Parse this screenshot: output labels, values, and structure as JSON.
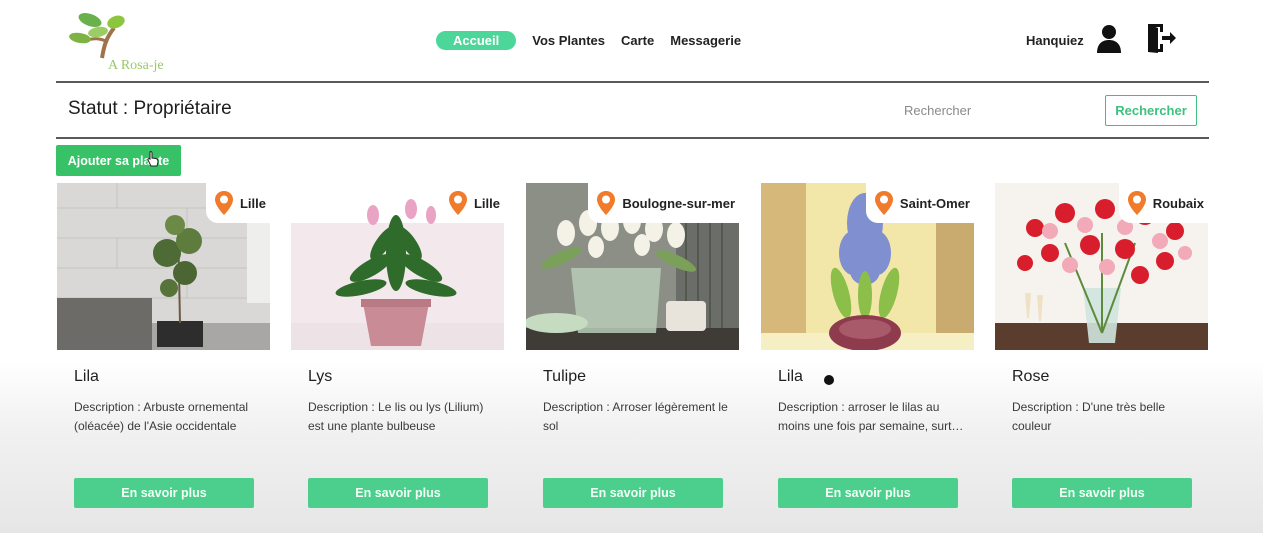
{
  "brand": {
    "name": "A Rosa-je"
  },
  "nav": {
    "items": [
      {
        "label": "Accueil",
        "active": true
      },
      {
        "label": "Vos Plantes",
        "active": false
      },
      {
        "label": "Carte",
        "active": false
      },
      {
        "label": "Messagerie",
        "active": false
      }
    ]
  },
  "user": {
    "name": "Hanquiez",
    "icon": "user-icon",
    "logout_icon": "logout-icon"
  },
  "status": {
    "text": "Statut : Propriétaire"
  },
  "search": {
    "placeholder": "Rechercher",
    "button_label": "Rechercher"
  },
  "actions": {
    "add_plant_label": "Ajouter sa plante"
  },
  "colors": {
    "accent": "#4cd69a",
    "button": "#4ccf8d",
    "add": "#37c267",
    "pin": "#f07b2a"
  },
  "plants": [
    {
      "name": "Lila",
      "location": "Lille",
      "description": "Description : Arbuste ornemental (oléacée) de l'Asie occidentale",
      "button_label": "En savoir plus"
    },
    {
      "name": "Lys",
      "location": "Lille",
      "description": "Description : Le lis ou lys (Lilium) est une plante bulbeuse",
      "button_label": "En savoir plus"
    },
    {
      "name": "Tulipe",
      "location": "Boulogne-sur-mer",
      "description": "Description : Arroser légèrement le sol",
      "button_label": "En savoir plus"
    },
    {
      "name": "Lila",
      "location": "Saint-Omer",
      "description": "Description : arroser le lilas au moins une fois par semaine, surtout en été",
      "button_label": "En savoir plus"
    },
    {
      "name": "Rose",
      "location": "Roubaix",
      "description": "Description : D'une très belle couleur",
      "button_label": "En savoir plus"
    }
  ]
}
